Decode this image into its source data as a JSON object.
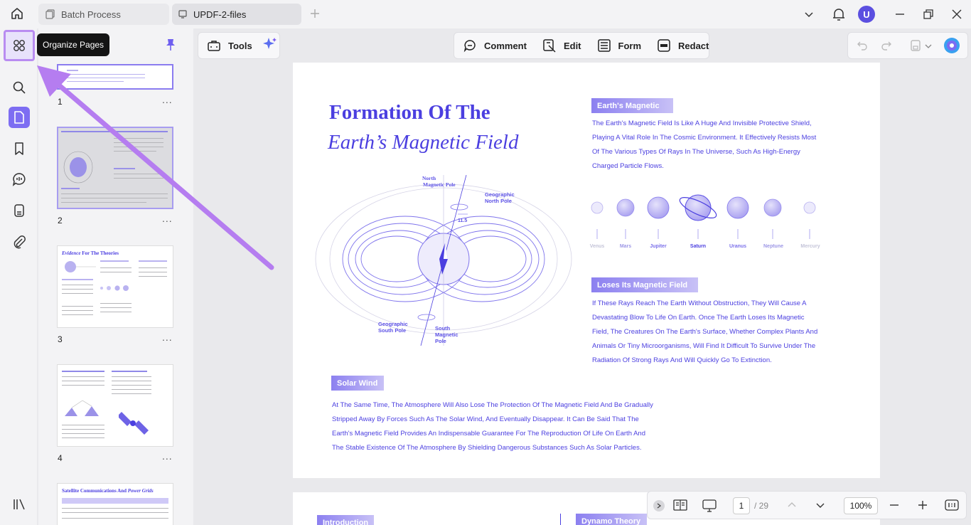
{
  "tabs": [
    {
      "label": "Batch Process"
    },
    {
      "label": "UPDF-2-files"
    }
  ],
  "user": {
    "initial": "U"
  },
  "sidebar": {
    "tooltip": "Organize Pages",
    "items": [
      "organize-pages",
      "search",
      "thumbnails",
      "bookmarks",
      "comments",
      "attachments-list",
      "attachments",
      "layers"
    ]
  },
  "thumbnails": {
    "pages": [
      {
        "number": "1",
        "menu": "..."
      },
      {
        "number": "2",
        "menu": "..."
      },
      {
        "number": "3",
        "menu": "...",
        "title_a": "Evidence",
        "title_b": "For The Theories"
      },
      {
        "number": "4",
        "menu": "..."
      },
      {
        "number": "5",
        "title_a": "Satellite Communications And",
        "title_b": "Power Grids"
      }
    ]
  },
  "toolbar": {
    "tools_label": "Tools",
    "comment_label": "Comment",
    "edit_label": "Edit",
    "form_label": "Form",
    "redact_label": "Redact"
  },
  "document": {
    "title_line1": "Formation Of The",
    "title_line2": "Earth’s Magnetic Field",
    "earths_magnetic": {
      "heading": "Earth's Magnetic",
      "lines": [
        "The Earth's Magnetic Field Is Like A Huge And Invisible Protective Shield,",
        "Playing A Vital Role In The Cosmic Environment. It Effectively Resists Most",
        "Of The Various Types Of Rays In The Universe, Such As High-Energy",
        "Charged Particle Flows."
      ]
    },
    "planets": [
      "Venus",
      "Mars",
      "Jupiter",
      "Saturn",
      "Uranus",
      "Neptune",
      "Mercury"
    ],
    "loses": {
      "heading": "Loses Its Magnetic Field",
      "lines": [
        "If These Rays Reach The Earth Without Obstruction, They Will Cause A",
        "Devastating Blow To Life On Earth. Once The Earth Loses Its Magnetic",
        "Field, The Creatures On The Earth's Surface, Whether Complex Plants And",
        "Animals Or Tiny Microorganisms, Will Find It Difficult To Survive Under The",
        "Radiation Of Strong Rays And Will Quickly Go To Extinction."
      ]
    },
    "solar_wind": {
      "heading": "Solar Wind",
      "lines": [
        "At The Same Time, The Atmosphere Will Also Lose The Protection Of The Magnetic Field And Be Gradually",
        "Stripped Away By Forces Such As The Solar Wind, And Eventually Disappear. It Can Be Said That The",
        "Earth's Magnetic Field Provides An Indispensable Guarantee For The Reproduction Of Life On Earth And",
        "The Stable Existence Of The Atmosphere By Shielding Dangerous Substances Such As Solar Particles."
      ]
    },
    "diagram": {
      "north_magnetic": [
        "North",
        "Magnetic Pole"
      ],
      "geo_north": [
        "Geographic",
        "North Pole"
      ],
      "angle": "11.5",
      "geo_south": [
        "Geographic",
        "South Pole"
      ],
      "south_magnetic": [
        "South",
        "Magnetic",
        "Pole"
      ]
    },
    "page2": {
      "intro": "Introduction",
      "dynamo": "Dynamo Theory"
    }
  },
  "navigation": {
    "current_page": "1",
    "total_pages": "/ 29",
    "zoom": "100%"
  },
  "colors": {
    "accent": "#4b3fe0",
    "arrow": "#b57df0"
  }
}
